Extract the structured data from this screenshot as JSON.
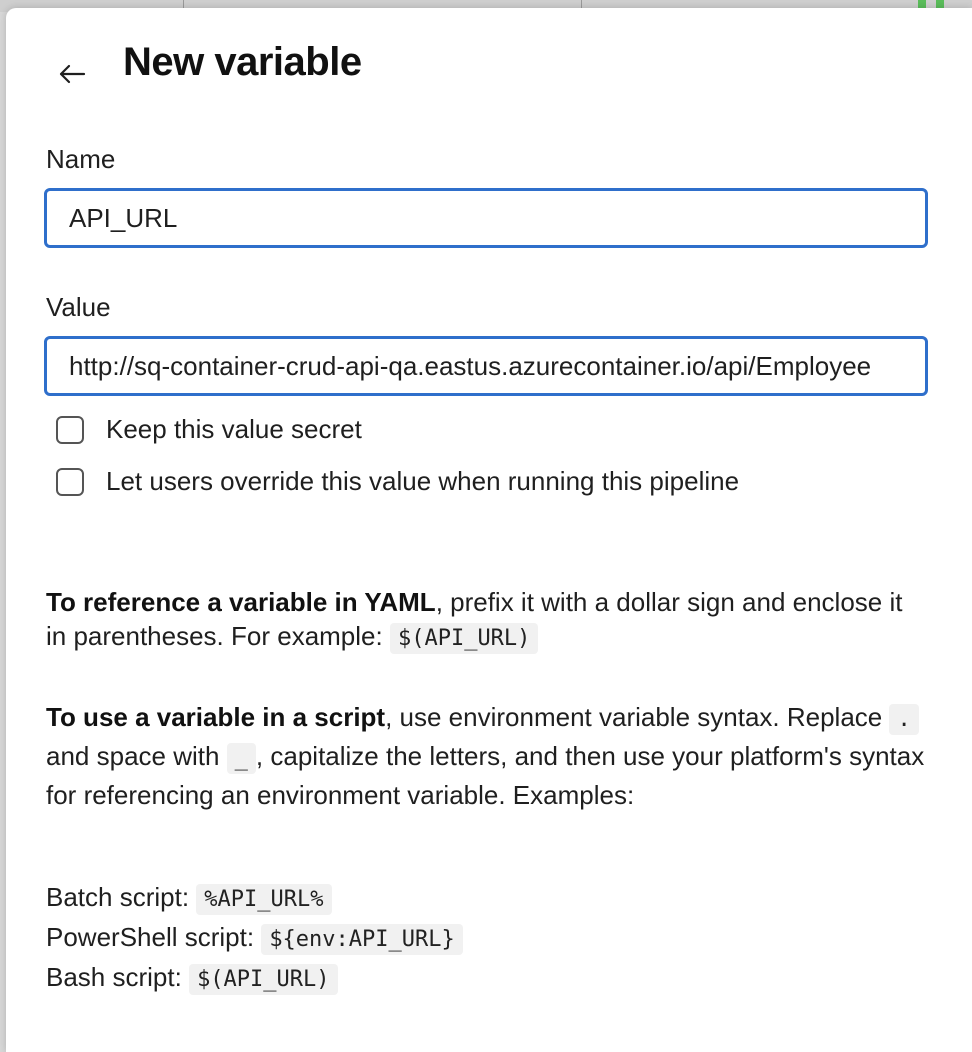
{
  "dialog": {
    "title": "New variable",
    "back_icon": "arrow-left-icon"
  },
  "name_field": {
    "label": "Name",
    "value": "API_URL"
  },
  "value_field": {
    "label": "Value",
    "value": "http://sq-container-crud-api-qa.eastus.azurecontainer.io/api/Employee"
  },
  "options": {
    "keep_secret_label": "Keep this value secret",
    "keep_secret_checked": false,
    "allow_override_label": "Let users override this value when running this pipeline",
    "allow_override_checked": false
  },
  "help": {
    "yaml_bold": "To reference a variable in YAML",
    "yaml_text_1": ", prefix it with a dollar sign and enclose it in parentheses. For example: ",
    "yaml_code": "$(API_URL)",
    "script_bold": "To use a variable in a script",
    "script_text_1": ", use environment variable syntax. Replace ",
    "script_code_dot": ".",
    "script_text_2": " and space with ",
    "script_code_underscore": "_",
    "script_text_3": ", capitalize the letters, and then use your platform's syntax for referencing an environment variable. Examples:",
    "examples": {
      "batch_label": "Batch script: ",
      "batch_code": "%API_URL%",
      "powershell_label": "PowerShell script: ",
      "powershell_code": "${env:API_URL}",
      "bash_label": "Bash script: ",
      "bash_code": "$(API_URL)"
    }
  },
  "colors": {
    "focus_border": "#2f6fcb",
    "code_background": "#f1f1f1"
  }
}
